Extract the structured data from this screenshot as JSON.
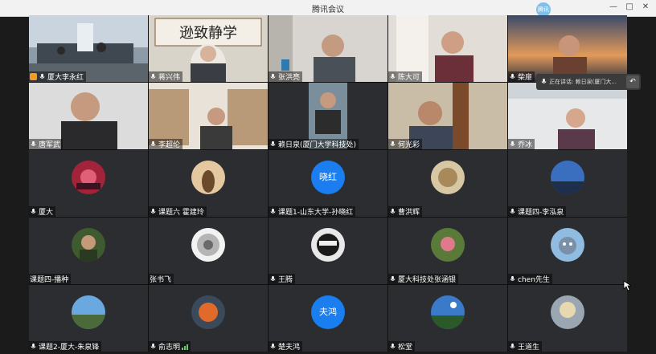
{
  "window": {
    "title": "腾讯会议",
    "logo_text": "腾讯",
    "controls": [
      "—",
      "□",
      "✕"
    ]
  },
  "speaking_indicator": {
    "text": "正在讲话: 赖日泉(厦门大..."
  },
  "participants": [
    {
      "name": "厦大李永红",
      "host": true,
      "video": "conference-room"
    },
    {
      "name": "蒋兴伟",
      "video": "calligraphy-wall"
    },
    {
      "name": "张洪亮",
      "video": "bright-room"
    },
    {
      "name": "陈大可",
      "video": "curtain-room"
    },
    {
      "name": "柴扉",
      "video": "sunset-lake"
    },
    {
      "name": "唐军武",
      "video": "white-wall"
    },
    {
      "name": "李超伦",
      "video": "bookshelf"
    },
    {
      "name": "赖日泉(厦门大学科技处)",
      "video": "dark-room"
    },
    {
      "name": "何光彩",
      "video": "door-room"
    },
    {
      "name": "乔冰",
      "video": "office-lights"
    },
    {
      "name": "厦大",
      "avatar": "red-abstract"
    },
    {
      "name": "课题六 霍建玲",
      "avatar": "sepia-figure"
    },
    {
      "name": "课题1-山东大学-孙晓红",
      "avatar_text": "晓红"
    },
    {
      "name": "曹洪辉",
      "avatar": "dry-plant"
    },
    {
      "name": "课题四-李泓泉",
      "avatar": "blue-sky"
    },
    {
      "name": "课题四-播种",
      "avatar": "green-figure"
    },
    {
      "name": "张书飞",
      "avatar": "dandelion"
    },
    {
      "name": "王腾",
      "avatar": "sunglasses-face"
    },
    {
      "name": "厦大科技处张涵银",
      "avatar": "flower"
    },
    {
      "name": "chen先生",
      "avatar": "cartoon-cat"
    },
    {
      "name": "课题2-厦大-朱泉锋",
      "avatar": "coast"
    },
    {
      "name": "俞志明",
      "avatar": "orange-splash"
    },
    {
      "name": "楚夫鸿",
      "avatar_text": "夫鸿"
    },
    {
      "name": "松堂",
      "avatar": "blue-landscape"
    },
    {
      "name": "王道生",
      "avatar": "hazy-sun"
    }
  ],
  "colors": {
    "background": "#1b1b1b",
    "tile": "#2b2d30",
    "avatar_blue": "#1a7df0",
    "host_orange": "#f59a23"
  }
}
